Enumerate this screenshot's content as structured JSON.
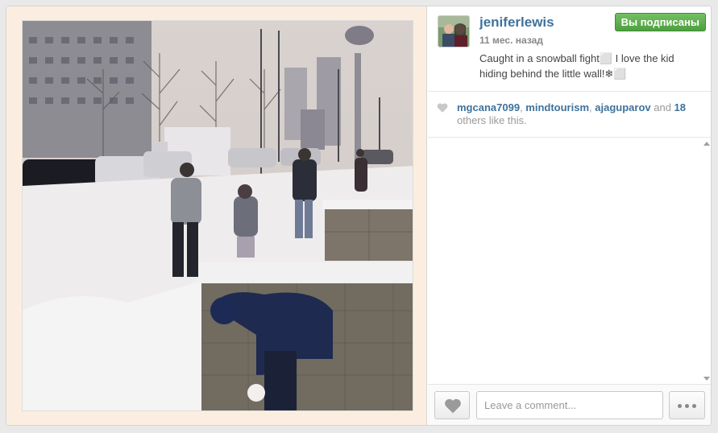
{
  "photo": {
    "alt_scene": "snowball-fight-photo"
  },
  "post": {
    "username": "jeniferlewis",
    "time_ago": "11 мес. назад",
    "follow_label": "Вы подписаны",
    "caption": "Caught in a snowball fight⬜ I love the kid hiding behind the little wall!❄⬜"
  },
  "likes": {
    "users": [
      "mgcana7099",
      "mindtourism",
      "ajaguparov"
    ],
    "separator": ", ",
    "and_text": " and ",
    "others_count": "18",
    "others_suffix": " others like this."
  },
  "footer": {
    "comment_placeholder": "Leave a comment..."
  },
  "colors": {
    "link": "#3f729b",
    "follow_green": "#6bb35a",
    "frame_bg": "#fbeee0"
  },
  "icons": {
    "like_small": "heart-icon",
    "like_button": "heart-icon",
    "more": "ellipsis-icon"
  }
}
